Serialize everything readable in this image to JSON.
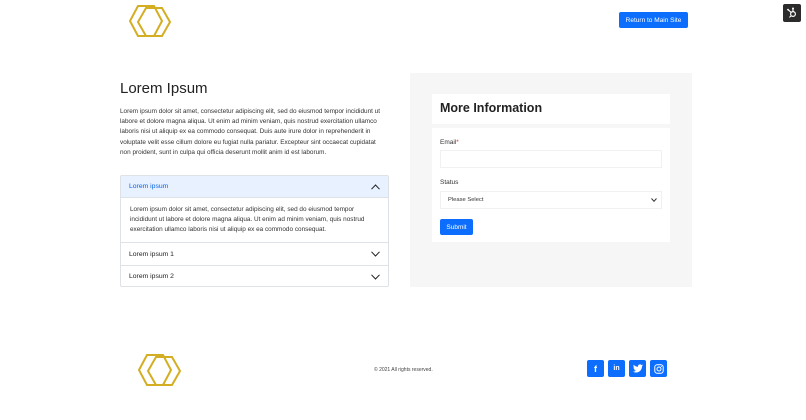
{
  "header": {
    "return_label": "Return to Main Site"
  },
  "main": {
    "title": "Lorem Ipsum",
    "intro": "Lorem ipsum dolor sit amet, consectetur adipiscing elit, sed do eiusmod tempor incididunt ut labore et dolore magna aliqua. Ut enim ad minim veniam, quis nostrud exercitation ullamco laboris nisi ut aliquip ex ea commodo consequat. Duis aute irure dolor in reprehenderit in voluptate velit esse cillum dolore eu fugiat nulla pariatur. Excepteur sint occaecat cupidatat non proident, sunt in culpa qui officia deserunt mollit anim id est laborum.",
    "accordion": [
      {
        "title": "Lorem ipsum",
        "expanded": true,
        "body": "Lorem ipsum dolor sit amet, consectetur adipiscing elit, sed do eiusmod tempor incididunt ut labore et dolore magna aliqua. Ut enim ad minim veniam, quis nostrud exercitation ullamco laboris nisi ut aliquip ex ea commodo consequat."
      },
      {
        "title": "Lorem ipsum 1",
        "expanded": false
      },
      {
        "title": "Lorem ipsum 2",
        "expanded": false
      }
    ]
  },
  "form": {
    "title": "More Information",
    "email_label": "Email",
    "email_required_mark": "*",
    "email_value": "",
    "status_label": "Status",
    "status_selected": "Please Select",
    "submit_label": "Submit"
  },
  "footer": {
    "copyright": "© 2021 All rights reserved.",
    "social": [
      {
        "icon": "facebook-icon",
        "glyph": "f"
      },
      {
        "icon": "linkedin-icon",
        "glyph": "in"
      },
      {
        "icon": "twitter-icon",
        "glyph": ""
      },
      {
        "icon": "instagram-icon",
        "glyph": ""
      }
    ]
  },
  "colors": {
    "accent": "#0d6efd",
    "logo_gold": "#d4ae22",
    "panel_bg": "#f6f6f6",
    "accordion_active_bg": "#e7f1ff",
    "accordion_active_text": "#0c63e4"
  }
}
